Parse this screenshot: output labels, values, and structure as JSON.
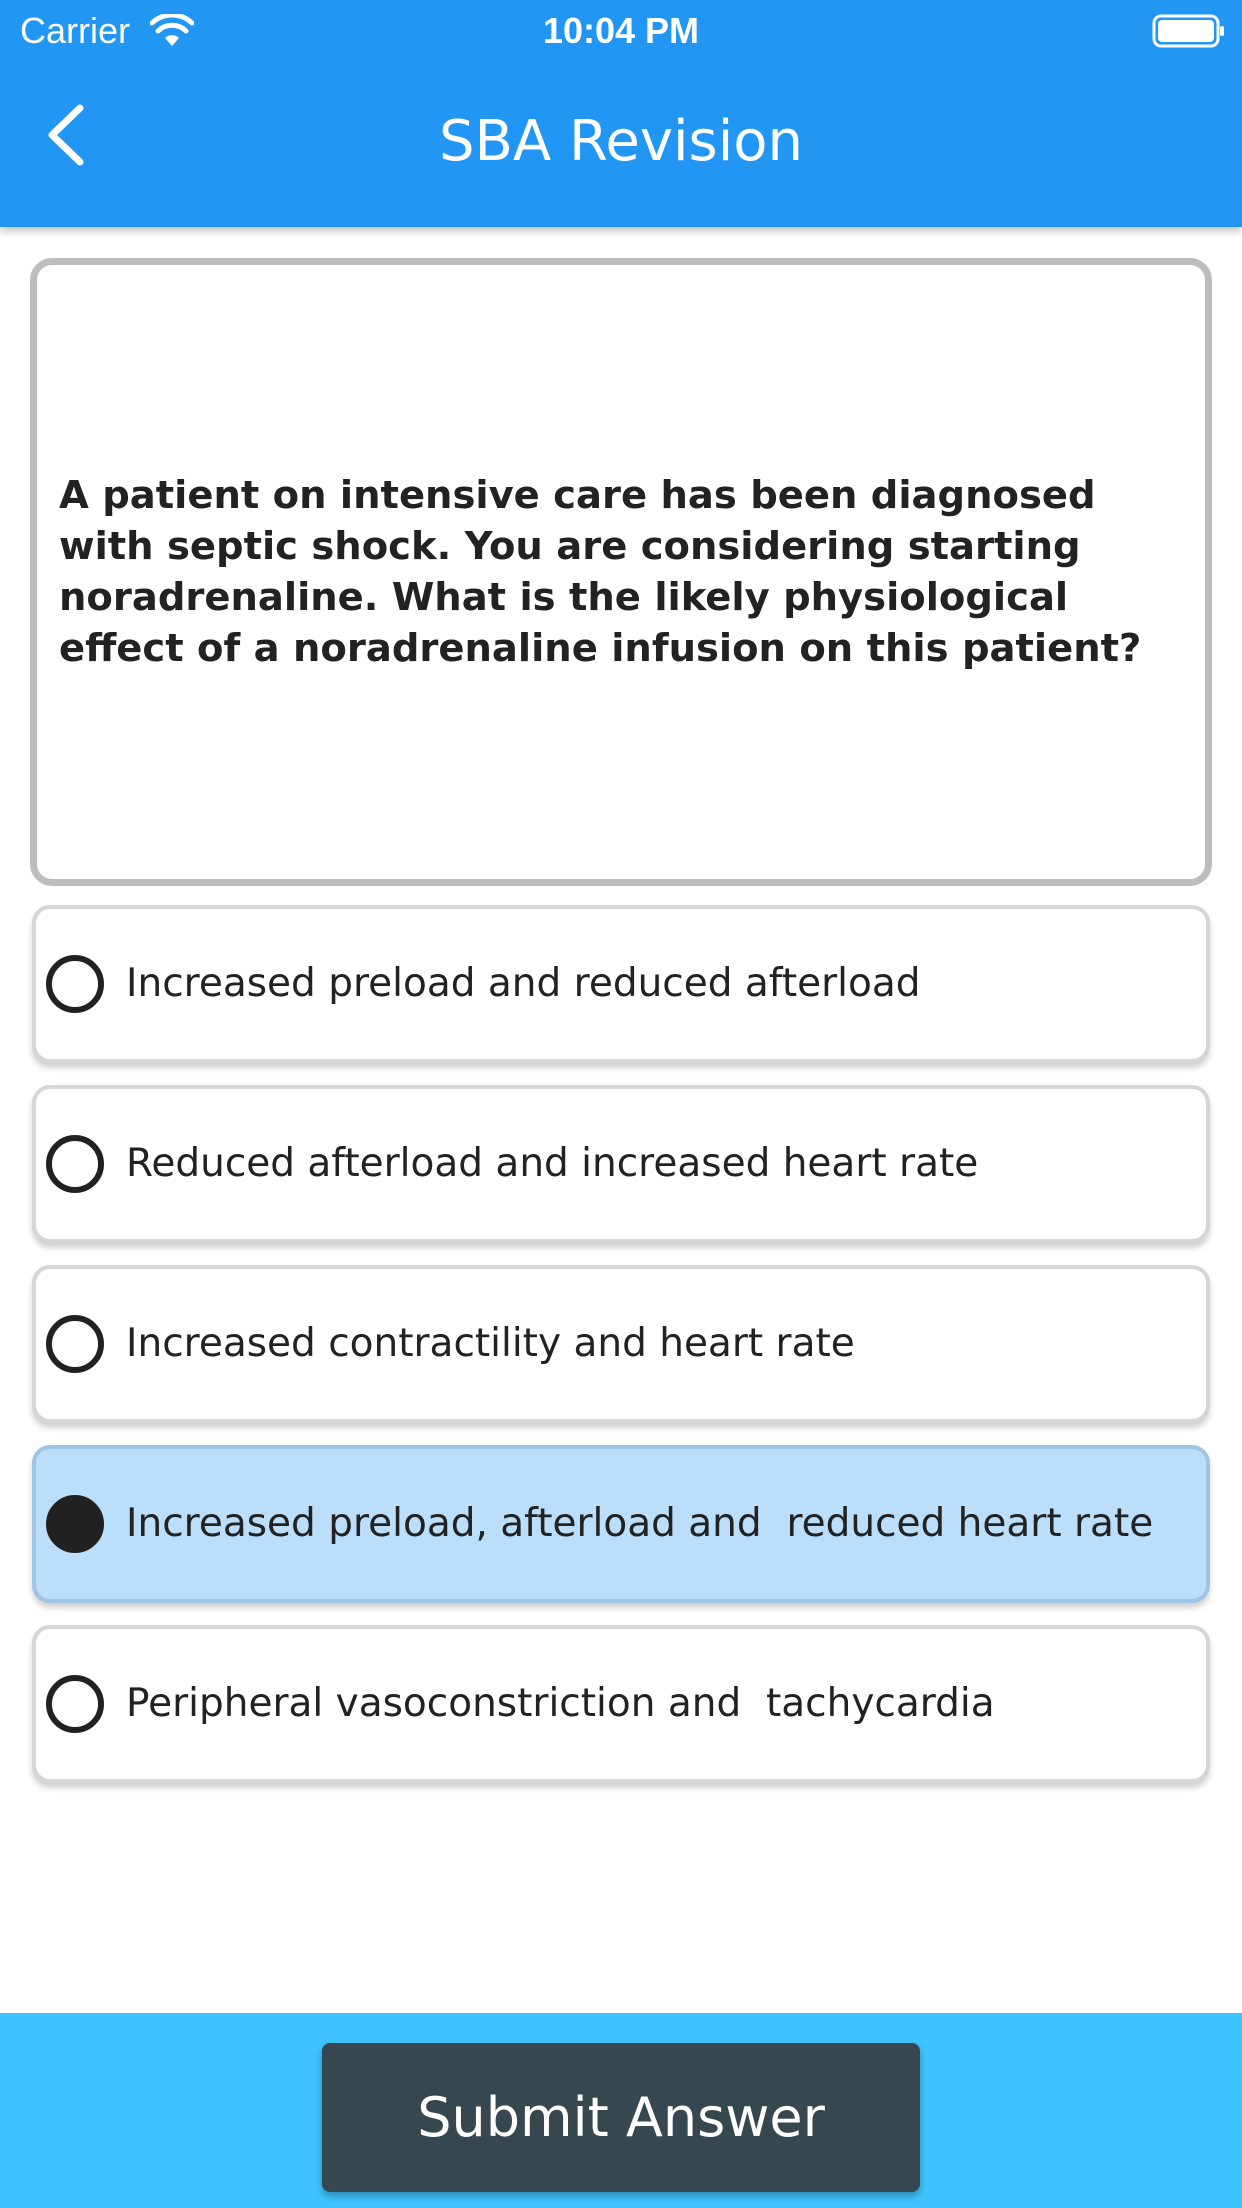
{
  "status_bar": {
    "carrier": "Carrier",
    "time": "10:04 PM",
    "wifi_icon": "wifi-icon",
    "battery_icon": "battery-full-icon"
  },
  "app_bar": {
    "title": "SBA Revision",
    "back_icon": "chevron-left-icon",
    "color": "#2196F3"
  },
  "question": {
    "text": "A patient on intensive care has been diagnosed with septic shock. You are considering starting noradrenaline. What is the likely physiological effect of a noradrenaline infusion on this patient?"
  },
  "options": [
    {
      "label": "Increased preload and reduced afterload",
      "selected": false
    },
    {
      "label": "Reduced afterload and increased heart rate",
      "selected": false
    },
    {
      "label": "Increased contractility and heart rate",
      "selected": false
    },
    {
      "label": "Increased preload, afterload and  reduced heart rate",
      "selected": true
    },
    {
      "label": "Peripheral vasoconstriction and  tachycardia",
      "selected": false
    }
  ],
  "selected_option_color": "#BBDEFB",
  "bottom_bar": {
    "color": "#40C4FF",
    "submit_label": "Submit Answer",
    "submit_color": "#37474F"
  }
}
